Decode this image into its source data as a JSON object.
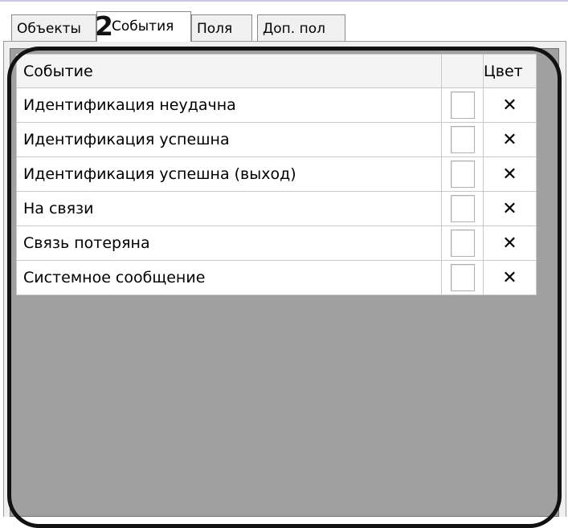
{
  "tabs": [
    {
      "label": "Объекты"
    },
    {
      "label": "События"
    },
    {
      "label": "Поля"
    },
    {
      "label": "Доп. пол"
    }
  ],
  "annotation_number": "2",
  "grid": {
    "headers": [
      "Событие",
      "",
      "Цвет"
    ],
    "rows": [
      {
        "event": "Идентификация неудачна",
        "color_mark": "✕"
      },
      {
        "event": "Идентификация успешна",
        "color_mark": "✕"
      },
      {
        "event": "Идентификация успешна (выход)",
        "color_mark": "✕"
      },
      {
        "event": "На связи",
        "color_mark": "✕"
      },
      {
        "event": "Связь потеряна",
        "color_mark": "✕"
      },
      {
        "event": "Системное сообщение",
        "color_mark": "✕"
      }
    ]
  }
}
